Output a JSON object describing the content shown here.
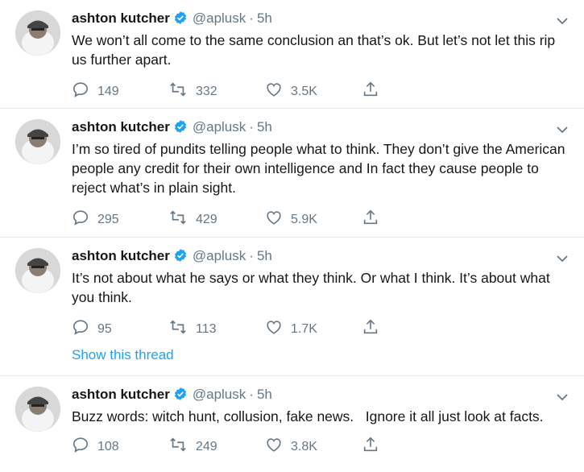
{
  "tweets": [
    {
      "name": "ashton kutcher",
      "handle": "@aplusk",
      "time": "5h",
      "text": "We won’t all come to the same conclusion an that’s ok. But let’s not let this rip us further apart.",
      "replies": "149",
      "retweets": "332",
      "likes": "3.5K"
    },
    {
      "name": "ashton kutcher",
      "handle": "@aplusk",
      "time": "5h",
      "text": "I’m so tired of pundits telling people what to think. They don’t give the American people any credit for their own intelligence and In fact they cause people to reject what’s in plain sight.",
      "replies": "295",
      "retweets": "429",
      "likes": "5.9K"
    },
    {
      "name": "ashton kutcher",
      "handle": "@aplusk",
      "time": "5h",
      "text": "It’s not about what he says or what they think. Or what I think. It’s about what you think.",
      "replies": "95",
      "retweets": "113",
      "likes": "1.7K",
      "thread_link": "Show this thread"
    },
    {
      "name": "ashton kutcher",
      "handle": "@aplusk",
      "time": "5h",
      "text": "Buzz words: witch hunt, collusion, fake news.   Ignore it all just look at facts.",
      "replies": "108",
      "retweets": "249",
      "likes": "3.8K"
    }
  ],
  "icons": {
    "reply": "reply-icon",
    "retweet": "retweet-icon",
    "like": "heart-icon",
    "share": "share-icon",
    "verified": "verified-badge-icon",
    "menu": "chevron-down-icon"
  },
  "colors": {
    "verified": "#1da1f2",
    "link": "#1da1f2",
    "secondary_text": "#657786",
    "divider": "#e6ecf0"
  }
}
